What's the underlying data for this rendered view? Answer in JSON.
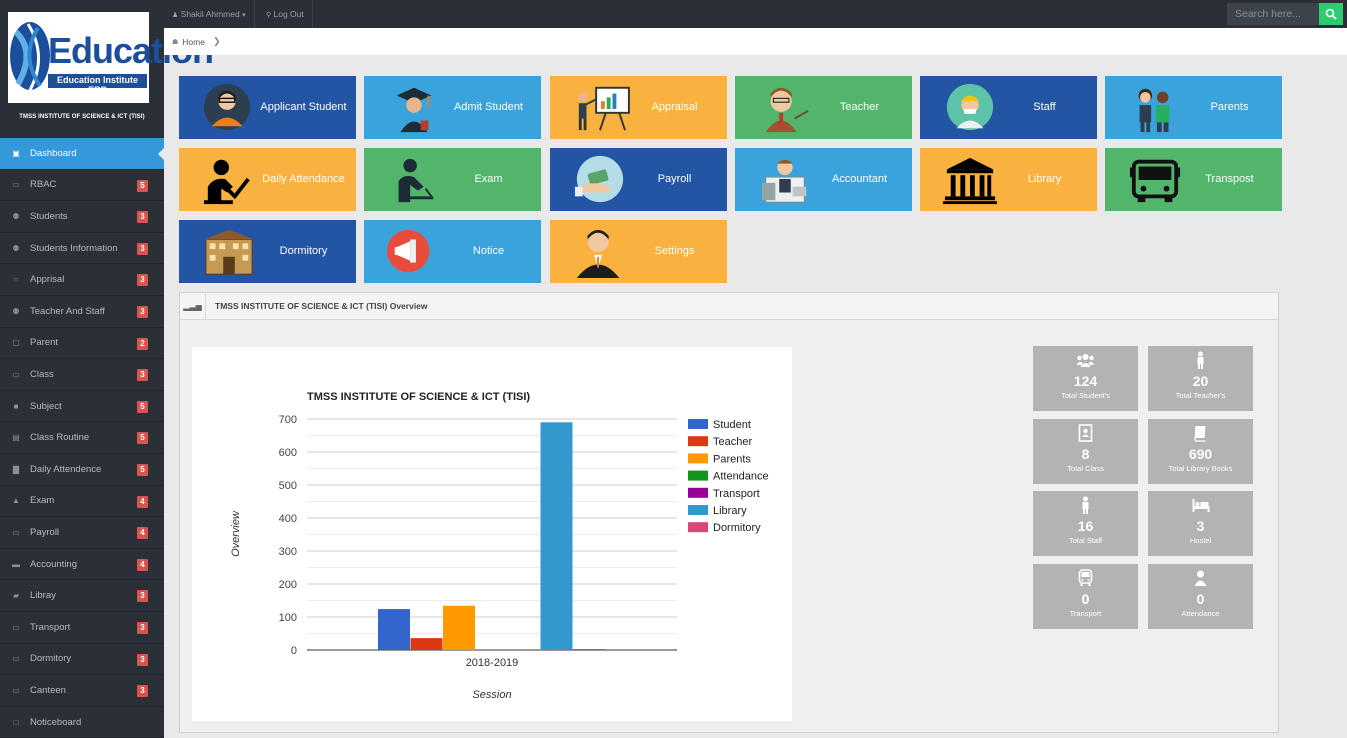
{
  "sidebar": {
    "logo_title": "Education",
    "logo_subtitle": "Education Institute ERP",
    "institute_name": "TMSS INSTITUTE OF SCIENCE & ICT (TISI)",
    "items": [
      {
        "label": "Dashboard",
        "icon": "dashboard-icon",
        "glyph": "▣",
        "active": true
      },
      {
        "label": "RBAC",
        "icon": "card-icon",
        "glyph": "▭",
        "badge": "5"
      },
      {
        "label": "Students",
        "icon": "users-icon",
        "glyph": "⚉",
        "badge": "3"
      },
      {
        "label": "Students Information",
        "icon": "users-icon",
        "glyph": "⚉",
        "badge": "3"
      },
      {
        "label": "Apprisal",
        "icon": "circle-icon",
        "glyph": "○",
        "badge": "3"
      },
      {
        "label": "Teacher And Staff",
        "icon": "users-icon",
        "glyph": "⚉",
        "badge": "3"
      },
      {
        "label": "Parent",
        "icon": "user-square-icon",
        "glyph": "▢",
        "badge": "2"
      },
      {
        "label": "Class",
        "icon": "card-icon",
        "glyph": "▭",
        "badge": "3"
      },
      {
        "label": "Subject",
        "icon": "bookmark-icon",
        "glyph": "■",
        "badge": "5"
      },
      {
        "label": "Class Routine",
        "icon": "calendar-icon",
        "glyph": "▤",
        "badge": "5"
      },
      {
        "label": "Daily Attendence",
        "icon": "bar-chart-icon",
        "glyph": "▇",
        "badge": "5"
      },
      {
        "label": "Exam",
        "icon": "graduation-cap-icon",
        "glyph": "▲",
        "badge": "4"
      },
      {
        "label": "Payroll",
        "icon": "money-icon",
        "glyph": "▭",
        "badge": "4"
      },
      {
        "label": "Accounting",
        "icon": "briefcase-icon",
        "glyph": "▬",
        "badge": "4"
      },
      {
        "label": "Libray",
        "icon": "book-icon",
        "glyph": "▰",
        "badge": "3"
      },
      {
        "label": "Transport",
        "icon": "card-icon",
        "glyph": "▭",
        "badge": "3"
      },
      {
        "label": "Dormitory",
        "icon": "card-icon",
        "glyph": "▭",
        "badge": "3"
      },
      {
        "label": "Canteen",
        "icon": "card-icon",
        "glyph": "▭",
        "badge": "3"
      },
      {
        "label": "Noticeboard",
        "icon": "window-icon",
        "glyph": "□"
      }
    ]
  },
  "topbar": {
    "user_name": "Shakil Ahmmed",
    "logout_label": "Log Out",
    "search_placeholder": "Search here..."
  },
  "breadcrumb": {
    "home_label": "Home"
  },
  "tiles": [
    {
      "label": "Applicant Student",
      "color": "navy",
      "icon": "applicant-student-icon"
    },
    {
      "label": "Admit Student",
      "color": "sky",
      "icon": "graduate-icon"
    },
    {
      "label": "Appraisal",
      "color": "orange",
      "icon": "presentation-board-icon"
    },
    {
      "label": "Teacher",
      "color": "green",
      "icon": "teacher-icon"
    },
    {
      "label": "Staff",
      "color": "navy",
      "icon": "worker-icon"
    },
    {
      "label": "Parents",
      "color": "sky",
      "icon": "parents-icon"
    },
    {
      "label": "Daily Attendance",
      "color": "orange",
      "icon": "attendance-check-icon"
    },
    {
      "label": "Exam",
      "color": "green",
      "icon": "exam-writing-icon"
    },
    {
      "label": "Payroll",
      "color": "navy",
      "icon": "payroll-money-icon"
    },
    {
      "label": "Accountant",
      "color": "sky",
      "icon": "accountant-icon"
    },
    {
      "label": "Library",
      "color": "orange",
      "icon": "library-building-icon"
    },
    {
      "label": "Transpost",
      "color": "green",
      "icon": "bus-icon"
    },
    {
      "label": "Dormitory",
      "color": "navy",
      "icon": "dormitory-building-icon"
    },
    {
      "label": "Notice",
      "color": "sky",
      "icon": "megaphone-icon"
    },
    {
      "label": "Settings",
      "color": "orange",
      "icon": "settings-person-icon"
    }
  ],
  "overview": {
    "title": "TMSS INSTITUTE OF SCIENCE & ICT (TISI) Overview"
  },
  "chart_data": {
    "type": "bar",
    "title": "TMSS INSTITUTE OF SCIENCE & ICT (TISI)",
    "xlabel": "Session",
    "ylabel": "Overview",
    "categories": [
      "2018-2019"
    ],
    "ylim": [
      0,
      700
    ],
    "yticks": [
      0,
      100,
      200,
      300,
      400,
      500,
      600,
      700
    ],
    "grid": true,
    "legend_position": "right",
    "series": [
      {
        "name": "Student",
        "values": [
          124
        ],
        "color": "#3366cc"
      },
      {
        "name": "Teacher",
        "values": [
          36
        ],
        "color": "#dc3912"
      },
      {
        "name": "Parents",
        "values": [
          134
        ],
        "color": "#ff9900"
      },
      {
        "name": "Attendance",
        "values": [
          0
        ],
        "color": "#109618"
      },
      {
        "name": "Transport",
        "values": [
          0
        ],
        "color": "#990099"
      },
      {
        "name": "Library",
        "values": [
          690
        ],
        "color": "#3399cc"
      },
      {
        "name": "Dormitory",
        "values": [
          3
        ],
        "color": "#dd4477"
      }
    ]
  },
  "stats": [
    {
      "value": "124",
      "label": "Total Student's",
      "icon": "users-group-icon"
    },
    {
      "value": "20",
      "label": "Total Teacher's",
      "icon": "male-icon"
    },
    {
      "value": "8",
      "label": "Total Class",
      "icon": "contact-book-icon"
    },
    {
      "value": "690",
      "label": "Total Library Books",
      "icon": "book-icon"
    },
    {
      "value": "16",
      "label": "Total Staff",
      "icon": "male-icon"
    },
    {
      "value": "3",
      "label": "Hostel",
      "icon": "bed-icon"
    },
    {
      "value": "0",
      "label": "Transport",
      "icon": "bus-icon"
    },
    {
      "value": "0",
      "label": "Attendance",
      "icon": "user-icon"
    }
  ],
  "colors": {
    "navy": "#2255a4",
    "sky": "#3aa3dc",
    "orange": "#f9b23f",
    "green": "#53b56c",
    "sidebar_bg": "#2b3037",
    "active": "#3498db",
    "badge": "#d9534f",
    "stat_bg": "#b3b3b3"
  }
}
